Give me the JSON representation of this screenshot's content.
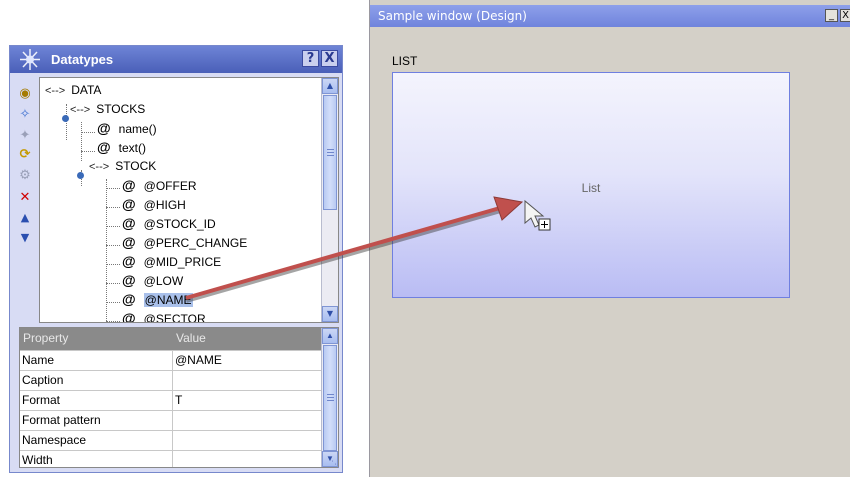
{
  "sample_window": {
    "title": "Sample window (Design)",
    "minimize_glyph": "_",
    "close_glyph": "X",
    "list_caption": "LIST",
    "list_text": "List"
  },
  "datatypes": {
    "title": "Datatypes",
    "help_glyph": "?",
    "close_glyph": "X",
    "tree": [
      {
        "label": "DATA",
        "type": "element"
      },
      {
        "label": "STOCKS",
        "type": "element"
      },
      {
        "label": "name()",
        "type": "attribute"
      },
      {
        "label": "text()",
        "type": "attribute"
      },
      {
        "label": "STOCK",
        "type": "element"
      },
      {
        "label": "@OFFER",
        "type": "attribute"
      },
      {
        "label": "@HIGH",
        "type": "attribute"
      },
      {
        "label": "@STOCK_ID",
        "type": "attribute"
      },
      {
        "label": "@PERC_CHANGE",
        "type": "attribute"
      },
      {
        "label": "@MID_PRICE",
        "type": "attribute"
      },
      {
        "label": "@LOW",
        "type": "attribute"
      },
      {
        "label": "@NAME",
        "type": "attribute",
        "selected": true
      },
      {
        "label": "@SECTOR",
        "type": "attribute"
      }
    ],
    "element_glyph": "<-->",
    "attribute_glyph": "@",
    "properties": {
      "headers": {
        "property": "Property",
        "value": "Value"
      },
      "rows": [
        {
          "name": "Name",
          "value": "@NAME"
        },
        {
          "name": "Caption",
          "value": ""
        },
        {
          "name": "Format",
          "value": "T"
        },
        {
          "name": "Format pattern",
          "value": ""
        },
        {
          "name": "Namespace",
          "value": ""
        },
        {
          "name": "Width",
          "value": ""
        }
      ]
    }
  },
  "colors": {
    "accent": "#6f83dc",
    "arrow": "#c0504d",
    "selection": "#a9c0ea"
  }
}
